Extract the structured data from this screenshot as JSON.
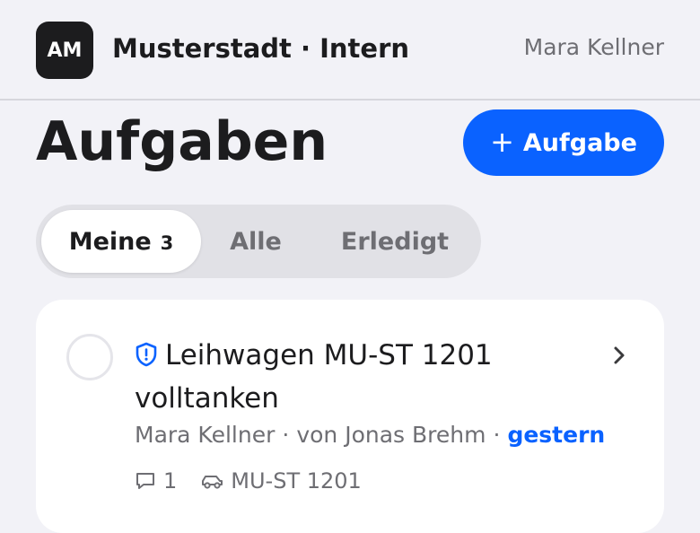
{
  "header": {
    "logo_initials": "AM",
    "org_name": "Musterstadt · Intern",
    "user_name": "Mara Kellner"
  },
  "page": {
    "title": "Aufgaben",
    "add_button_label": "Aufgabe",
    "add_button_icon": "plus-icon"
  },
  "tabs": [
    {
      "label": "Meine",
      "count": "3",
      "selected": true
    },
    {
      "label": "Alle",
      "selected": false
    },
    {
      "label": "Erledigt",
      "selected": false
    }
  ],
  "tasks": [
    {
      "title": "Leihwagen MU-ST 1201 volltanken",
      "type_icon": "shield-icon",
      "assignee": "Mara Kellner",
      "created_by": "von Jonas Brehm",
      "when": "gestern",
      "comment_count": "1",
      "vehicle": "MU-ST 1201"
    }
  ],
  "colors": {
    "accent": "#0a62ff",
    "background": "#f2f2f7",
    "text": "#1c1c1e",
    "secondary_text": "#6e6e73",
    "logo_bg": "#1c1c1e"
  }
}
